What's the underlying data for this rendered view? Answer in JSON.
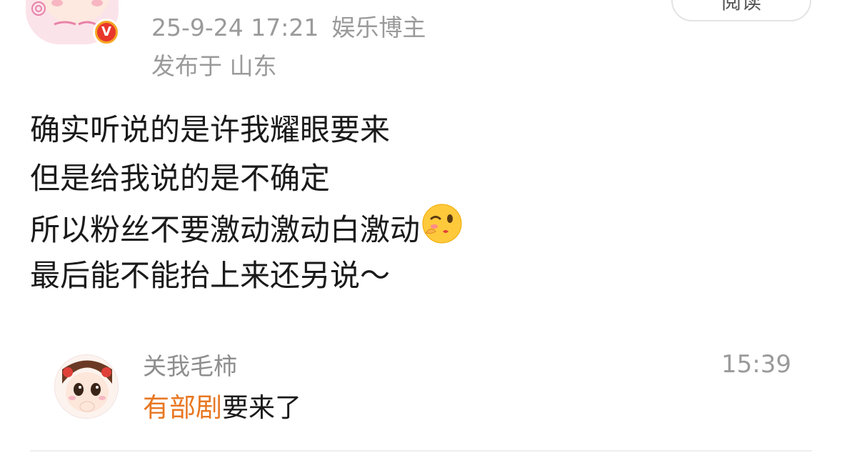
{
  "post": {
    "date": "25-9-24 17:21",
    "role": "娱乐博主",
    "location": "发布于 山东",
    "read_label": "阅读",
    "lines": [
      "确实听说的是许我耀眼要来",
      "但是给我说的是不确定",
      "所以粉丝不要激动激动白激动",
      "最后能不能抬上来还另说～"
    ],
    "emoji": "wink-kiss-emoji"
  },
  "comment": {
    "author": "关我毛柿",
    "time": "15:39",
    "highlight": "有部剧",
    "rest": "要来了"
  },
  "colors": {
    "meta_gray": "#9a9a9a",
    "highlight_orange": "#e87722",
    "verified_red": "#e8372b",
    "verified_gold": "#f5a623"
  }
}
